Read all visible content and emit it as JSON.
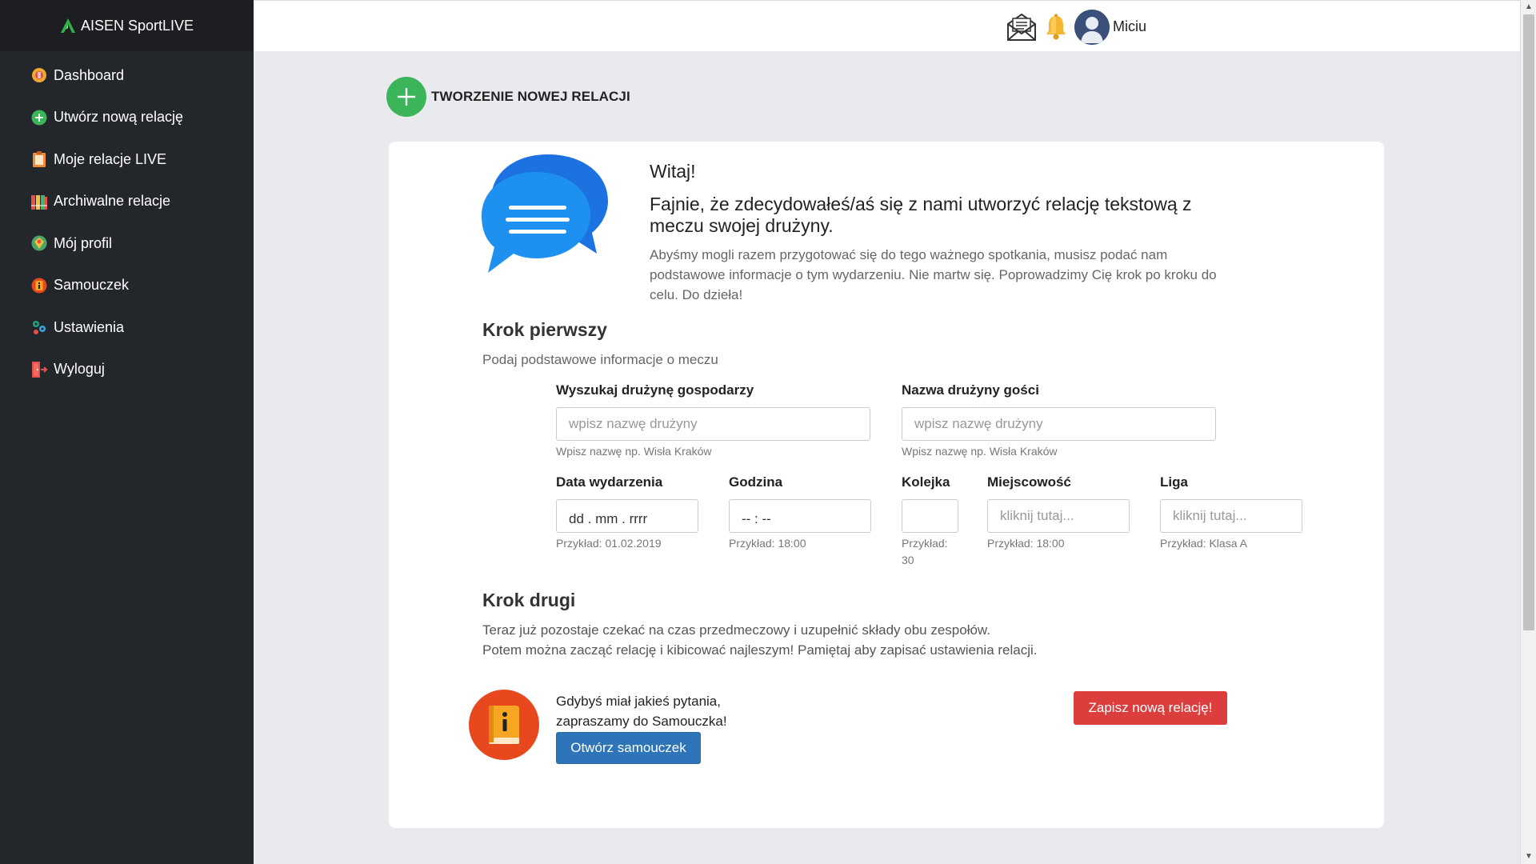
{
  "brand": {
    "name": "AISEN SportLIVE"
  },
  "sidebar": {
    "items": [
      {
        "label": "Dashboard",
        "icon": "dashboard-icon"
      },
      {
        "label": "Utwórz nową relację",
        "icon": "plus-circle-icon"
      },
      {
        "label": "Moje relacje LIVE",
        "icon": "clipboard-icon"
      },
      {
        "label": "Archiwalne relacje",
        "icon": "archive-books-icon"
      },
      {
        "label": "Mój profil",
        "icon": "profile-badge-icon"
      },
      {
        "label": "Samouczek",
        "icon": "tutorial-book-icon"
      },
      {
        "label": "Ustawienia",
        "icon": "settings-icon"
      },
      {
        "label": "Wyloguj",
        "icon": "logout-door-icon"
      }
    ]
  },
  "topbar": {
    "username": "Miciu",
    "icons": [
      "mail-icon",
      "bell-icon",
      "avatar"
    ]
  },
  "page": {
    "title": "TWORZENIE NOWEJ RELACJI"
  },
  "welcome": {
    "hello": "Witaj!",
    "lead": "Fajnie, że zdecydowałeś/aś się z nami utworzyć relację tekstową z meczu swojej drużyny.",
    "desc": "Abyśmy mogli razem przygotować się do tego ważnego spotkania, musisz podać nam podstawowe informacje o tym wydarzeniu. Nie martw się. Poprowadzimy Cię krok po kroku do celu. Do dzieła!"
  },
  "step1": {
    "title": "Krok pierwszy",
    "subtitle": "Podaj podstawowe informacje o meczu",
    "home_team": {
      "label": "Wyszukaj drużynę gospodarzy",
      "placeholder": "wpisz nazwę drużyny",
      "hint": "Wpisz nazwę np. Wisła Kraków"
    },
    "away_team": {
      "label": "Nazwa drużyny gości",
      "placeholder": "wpisz nazwę drużyny",
      "hint": "Wpisz nazwę np. Wisła Kraków"
    },
    "date": {
      "label": "Data wydarzenia",
      "value": "dd . mm . rrrr",
      "hint": "Przykład: 01.02.2019"
    },
    "time": {
      "label": "Godzina",
      "value": "-- : --",
      "hint": "Przykład: 18:00"
    },
    "round": {
      "label": "Kolejka",
      "value": "",
      "hint": "Przykład: 30"
    },
    "city": {
      "label": "Miejscowość",
      "placeholder": "kliknij tutaj...",
      "hint": "Przykład: 18:00"
    },
    "league": {
      "label": "Liga",
      "placeholder": "kliknij tutaj...",
      "hint": "Przykład: Klasa A"
    }
  },
  "step2": {
    "title": "Krok drugi",
    "line1": "Teraz już pozostaje czekać na czas przedmeczowy i uzupełnić składy obu zespołów.",
    "line2": "Potem można zacząć relację i kibicować najleszym! Pamiętaj aby zapisać ustawienia relacji."
  },
  "help": {
    "line1": "Gdybyś miał jakieś pytania,",
    "line2": "zapraszamy do Samouczka!",
    "button": "Otwórz samouczek"
  },
  "save_button": "Zapisz nową relację!",
  "colors": {
    "sidebar": "#23262b",
    "accent_green": "#3cb55a",
    "primary_blue": "#2d74b8",
    "danger_red": "#dc3d3d",
    "tutorial_orange": "#e8481e"
  }
}
